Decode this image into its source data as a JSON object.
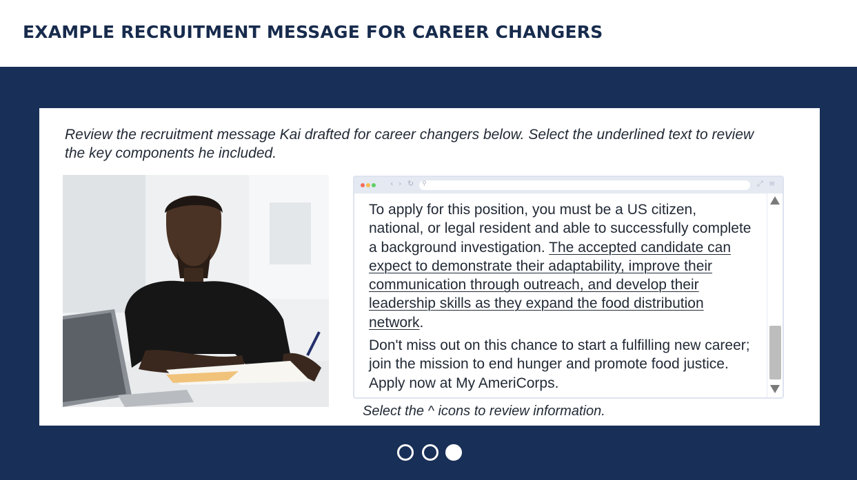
{
  "header": {
    "title": "EXAMPLE RECRUITMENT MESSAGE FOR CAREER CHANGERS"
  },
  "card": {
    "instructions": "Review the recruitment message Kai drafted for career changers below. Select the underlined text to review the key components he included.",
    "hint": "Select the ^ icons to review information."
  },
  "browser": {
    "paragraph1_start": "To apply for this position, you must be a US citizen, national, or legal resident and able to successfully complete a background investigation. ",
    "paragraph1_link": "The accepted candidate can expect to demonstrate their adaptability, improve their communication through outreach, and develop their leadership skills as they expand the food distribution network",
    "paragraph1_end": ".",
    "paragraph2": "Don't miss out on this chance to start a fulfilling new career; join the mission to end hunger and promote food justice. Apply now at My AmeriCorps.",
    "icons": [
      "back-icon",
      "forward-icon",
      "reload-icon",
      "search-icon",
      "expand-icon",
      "menu-icon"
    ]
  },
  "pager": {
    "count": 3,
    "active_index": 2
  },
  "colors": {
    "header_text": "#172b4d",
    "stage_background": "#182f57",
    "body_text": "#222a36"
  }
}
